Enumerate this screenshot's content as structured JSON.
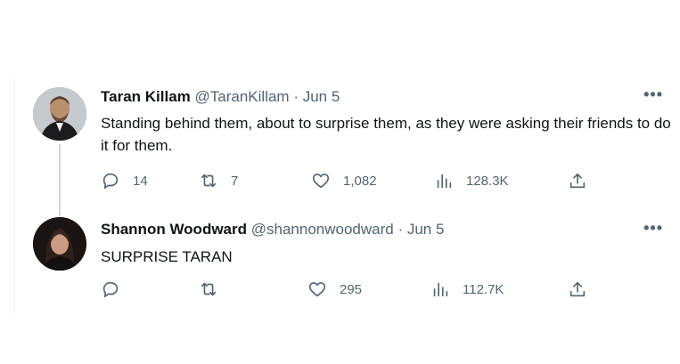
{
  "tweets": [
    {
      "name": "Taran Killam",
      "handle": "@TaranKillam",
      "date": "· Jun 5",
      "more": "•••",
      "text": "Standing behind them, about to surprise them, as they were asking their friends to do it for them.",
      "replies": "14",
      "retweets": "7",
      "likes": "1,082",
      "views": "128.3K"
    },
    {
      "name": "Shannon Woodward",
      "handle": "@shannonwoodward",
      "date": "· Jun 5",
      "more": "•••",
      "text": "SURPRISE TARAN",
      "replies": "",
      "retweets": "",
      "likes": "295",
      "views": "112.7K"
    }
  ],
  "icons": [
    "reply-icon",
    "retweet-icon",
    "like-icon",
    "views-icon",
    "share-icon"
  ],
  "colors": {
    "text": "#0f1419",
    "muted": "#536471",
    "thread_line": "#cfd9de"
  }
}
